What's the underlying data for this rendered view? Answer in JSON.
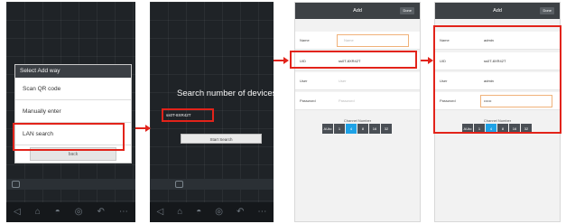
{
  "screen1": {
    "dialog": {
      "title": "Select Add way",
      "items": [
        "Scan QR code",
        "Manually enter",
        "LAN search"
      ],
      "cancel_label": "back"
    },
    "nav_icons": [
      "back-icon",
      "home-icon",
      "alarm-icon",
      "recent-icon",
      "return-icon",
      "more-icon"
    ]
  },
  "screen2": {
    "search_text": "Search number of devices:1",
    "device_id": "ss0T-8XR42T",
    "start_label": "Start Search",
    "nav_icons": [
      "back-icon",
      "home-icon",
      "alarm-icon",
      "recent-icon",
      "return-icon",
      "more-icon"
    ]
  },
  "screen3": {
    "header_title": "Add",
    "done_label": "Done",
    "fields": [
      {
        "label": "Name",
        "value": "",
        "placeholder": "Name"
      },
      {
        "label": "UID",
        "value": "ss0T-8XR42T",
        "placeholder": ""
      },
      {
        "label": "User",
        "value": "",
        "placeholder": "User"
      },
      {
        "label": "Password",
        "value": "",
        "placeholder": "Password"
      }
    ],
    "channel_label": "Channel Number",
    "channels": [
      "AUto",
      "1",
      "4",
      "8",
      "16",
      "32"
    ],
    "selected_channel": "4"
  },
  "screen4": {
    "header_title": "Add",
    "done_label": "Done",
    "fields": [
      {
        "label": "Name",
        "value": "admin"
      },
      {
        "label": "UID",
        "value": "ss0T-8XR42T"
      },
      {
        "label": "User",
        "value": "admin"
      },
      {
        "label": "Password",
        "value": "••••••"
      }
    ],
    "channel_label": "Channel Number",
    "channels": [
      "AUto",
      "1",
      "4",
      "8",
      "16",
      "32"
    ],
    "selected_channel": "4"
  },
  "colors": {
    "highlight": "#e2231a",
    "selected_channel": "#1fa2e6",
    "dark_bg": "#1f2327",
    "header_bg": "#3d4145"
  }
}
